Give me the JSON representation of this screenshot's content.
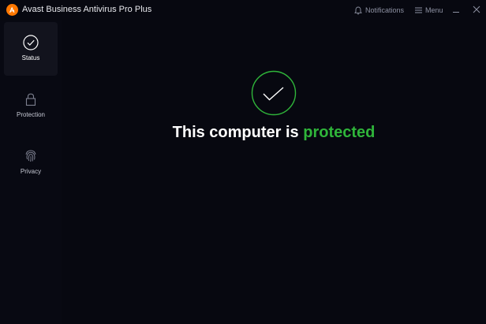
{
  "app": {
    "title": "Avast Business Antivirus Pro Plus",
    "logo_icon": "avast-logo-icon",
    "accent_color": "#ff7800"
  },
  "titlebar": {
    "notifications_label": "Notifications",
    "notifications_icon": "bell-icon",
    "menu_label": "Menu",
    "menu_icon": "hamburger-icon",
    "minimize_icon": "minimize-icon",
    "close_icon": "close-icon"
  },
  "sidebar": {
    "items": [
      {
        "label": "Status",
        "icon": "checkmark-circle-icon",
        "active": true
      },
      {
        "label": "Protection",
        "icon": "lock-icon",
        "active": false
      },
      {
        "label": "Privacy",
        "icon": "fingerprint-icon",
        "active": false
      }
    ]
  },
  "main": {
    "status_icon": "checkmark-circle-icon",
    "status_prefix": "This computer is ",
    "status_word": "protected",
    "status_color": "#2fb53a"
  }
}
